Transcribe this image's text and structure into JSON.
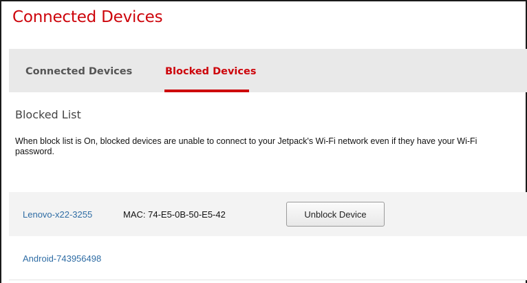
{
  "page": {
    "title": "Connected Devices"
  },
  "tabs": [
    {
      "label": "Connected Devices",
      "active": false
    },
    {
      "label": "Blocked Devices",
      "active": true
    }
  ],
  "colors": {
    "accent": "#cd040b",
    "link": "#2e6ca4",
    "tab_bar": "#e9e9e9"
  },
  "blocked_list": {
    "title": "Blocked List",
    "description": "When block list is On, blocked devices are unable to connect to your Jetpack's Wi-Fi network even if they have your Wi-Fi password.",
    "devices": [
      {
        "name": "Lenovo-x22-3255",
        "mac": "MAC: 74-E5-0B-50-E5-42",
        "button_label": "Unblock Device"
      },
      {
        "name": "Android-743956498"
      }
    ]
  }
}
